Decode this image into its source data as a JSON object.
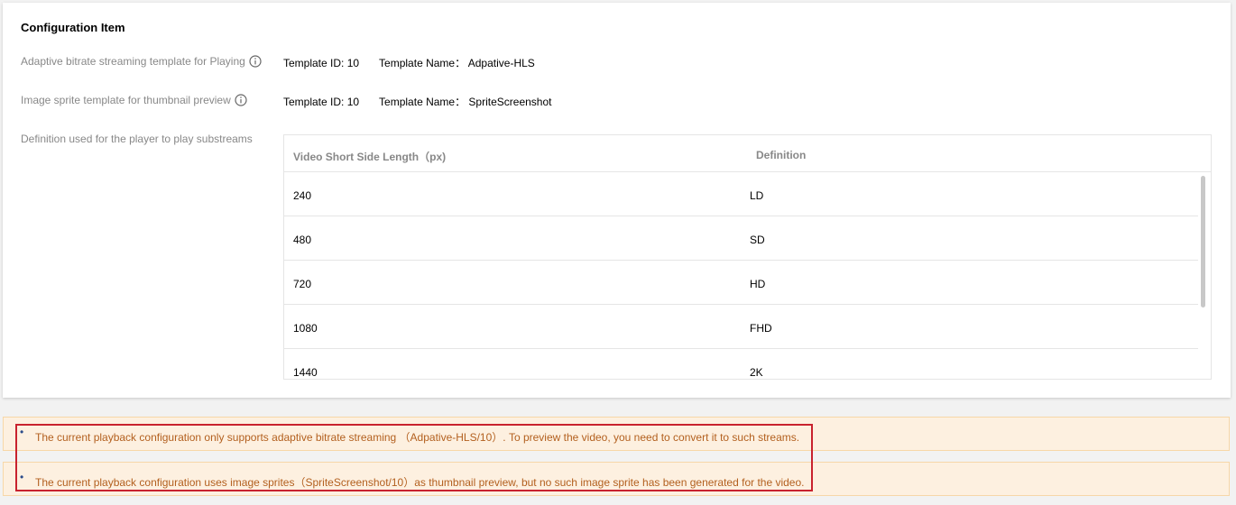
{
  "config": {
    "title": "Configuration Item",
    "rows": [
      {
        "label": "Adaptive bitrate streaming template for Playing",
        "template_id": "Template ID: 10",
        "template_name": "Template Name：  Adpative-HLS"
      },
      {
        "label": "Image sprite template for thumbnail preview",
        "template_id": "Template ID: 10",
        "template_name": "Template Name：  SpriteScreenshot"
      }
    ],
    "definition_label": "Definition used for the player to play substreams",
    "table": {
      "headers": [
        "Video Short Side Length（px)",
        "Definition"
      ],
      "rows": [
        [
          "240",
          "LD"
        ],
        [
          "480",
          "SD"
        ],
        [
          "720",
          "HD"
        ],
        [
          "1080",
          "FHD"
        ],
        [
          "1440",
          "2K"
        ]
      ]
    }
  },
  "notices": [
    "The current playback configuration only supports adaptive bitrate streaming （Adpative-HLS/10）. To preview the video, you need to convert it to such streams.",
    "The current playback configuration uses image sprites（SpriteScreenshot/10）as thumbnail preview, but no such image sprite has been generated for the video."
  ],
  "icons": {
    "info": "info-circle-icon",
    "bullet": "•"
  },
  "colors": {
    "notice_bg": "#fdf0e0",
    "notice_text": "#b3601f",
    "highlight_border": "#c8222e"
  }
}
